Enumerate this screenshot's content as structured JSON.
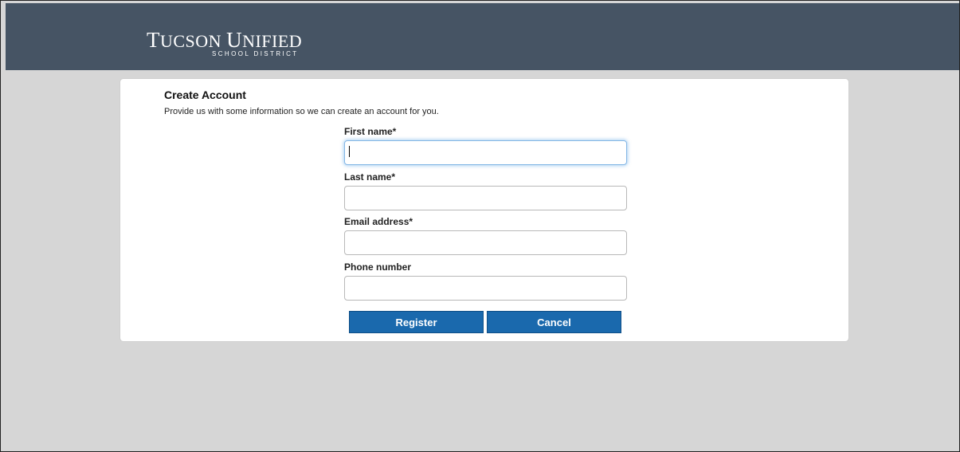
{
  "header": {
    "logo_line1": "Tucson Unified",
    "logo_line2": "SCHOOL DISTRICT",
    "bg_color": "#465464"
  },
  "form": {
    "title": "Create Account",
    "subtitle": "Provide us with some information so we can create an account for you.",
    "fields": [
      {
        "label": "First name*",
        "value": "",
        "placeholder": ""
      },
      {
        "label": "Last name*",
        "value": "",
        "placeholder": ""
      },
      {
        "label": "Email address*",
        "value": "",
        "placeholder": ""
      },
      {
        "label": "Phone number",
        "value": "",
        "placeholder": ""
      }
    ],
    "buttons": {
      "register": "Register",
      "cancel": "Cancel"
    },
    "button_color": "#1a69ad"
  }
}
